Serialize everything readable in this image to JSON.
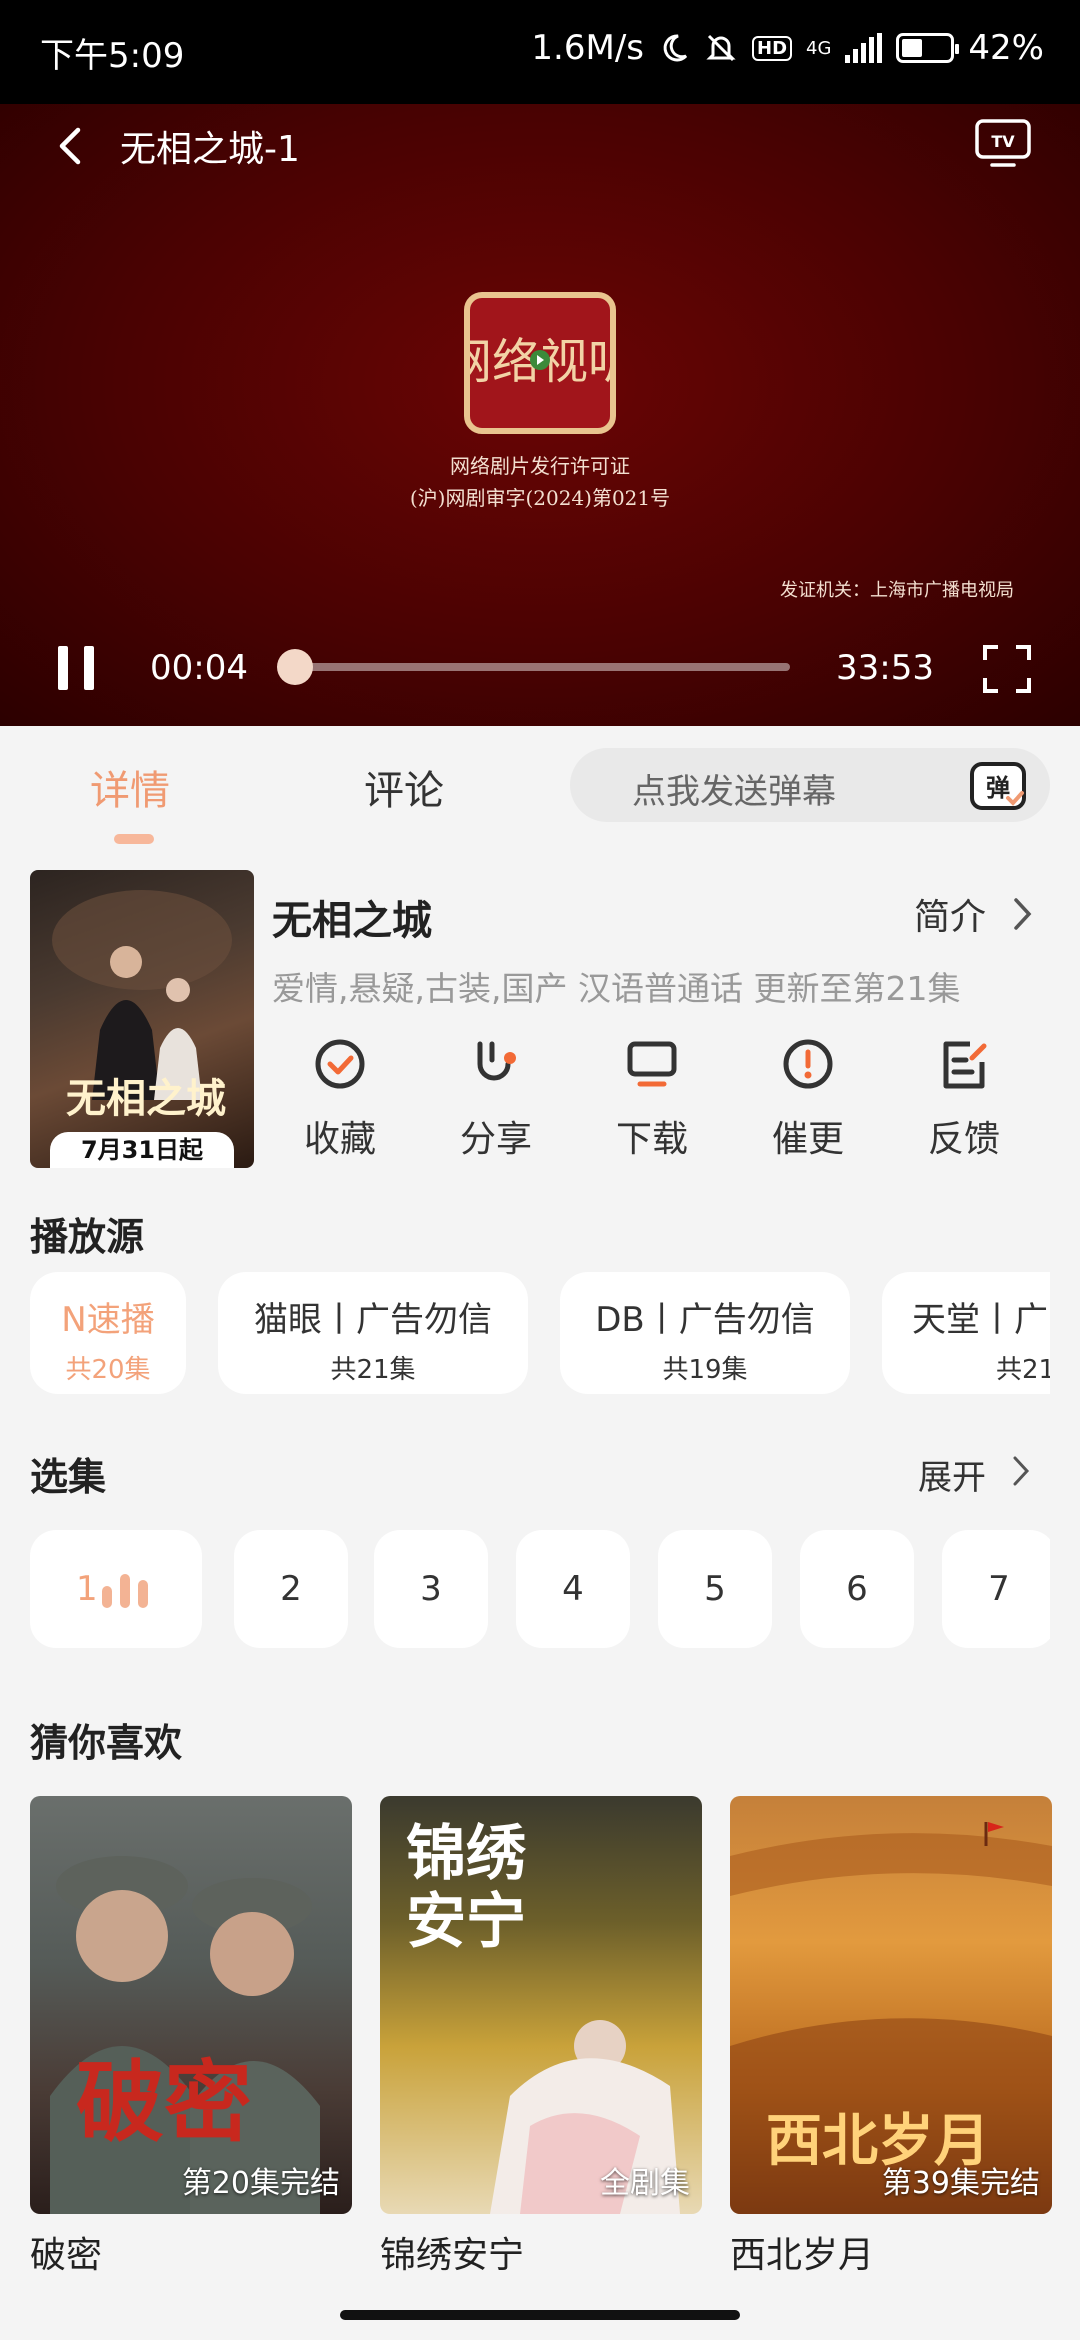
{
  "status_bar": {
    "time": "下午5:09",
    "network_speed": "1.6M/s",
    "network_type": "4G",
    "hd_label": "HD",
    "battery": "42%",
    "icons": [
      "moon-icon",
      "mute-bell-icon",
      "hd-icon",
      "signal-icon",
      "battery-icon"
    ]
  },
  "player": {
    "title": "无相之城-1",
    "license_line1": "网络剧片发行许可证",
    "license_line2": "(沪)网剧审字(2024)第021号",
    "issuer": "发证机关：上海市广播电视局",
    "seal_text": "网络视听",
    "current_time": "00:04",
    "total_time": "33:53",
    "progress": 0.002
  },
  "tabs": {
    "detail": "详情",
    "comment": "评论",
    "danmaku_placeholder": "点我发送弹幕",
    "danmaku_icon_text": "弹"
  },
  "show": {
    "title": "无相之城",
    "intro_label": "简介",
    "tags": "爱情,悬疑,古装,国产 汉语普通话 更新至第21集",
    "poster_title": "无相之城",
    "poster_date": "7月31日起"
  },
  "actions": [
    {
      "label": "收藏",
      "icon": "favorite-check-icon"
    },
    {
      "label": "分享",
      "icon": "share-icon"
    },
    {
      "label": "下载",
      "icon": "download-icon"
    },
    {
      "label": "催更",
      "icon": "urge-update-icon"
    },
    {
      "label": "反馈",
      "icon": "feedback-icon"
    }
  ],
  "sources": {
    "title": "播放源",
    "items": [
      {
        "name": "N速播",
        "count": "共20集"
      },
      {
        "name": "猫眼丨广告勿信",
        "count": "共21集"
      },
      {
        "name": "DB丨广告勿信",
        "count": "共19集"
      },
      {
        "name": "天堂丨广",
        "count": "共21"
      }
    ]
  },
  "episodes": {
    "title": "选集",
    "expand_label": "展开",
    "items": [
      "1",
      "2",
      "3",
      "4",
      "5",
      "6",
      "7"
    ]
  },
  "recommendations": {
    "title": "猜你喜欢",
    "items": [
      {
        "name": "破密",
        "badge": "第20集完结",
        "cover_title": "破密"
      },
      {
        "name": "锦绣安宁",
        "badge": "全剧集",
        "cover_title": "锦绣安宁"
      },
      {
        "name": "西北岁月",
        "badge": "第39集完结",
        "cover_title": "西北岁月"
      }
    ]
  },
  "colors": {
    "accent": "#f09a72",
    "accent_light": "#f3b394",
    "video_bg": "#4a0202",
    "page_bg": "#f4f4f4"
  }
}
